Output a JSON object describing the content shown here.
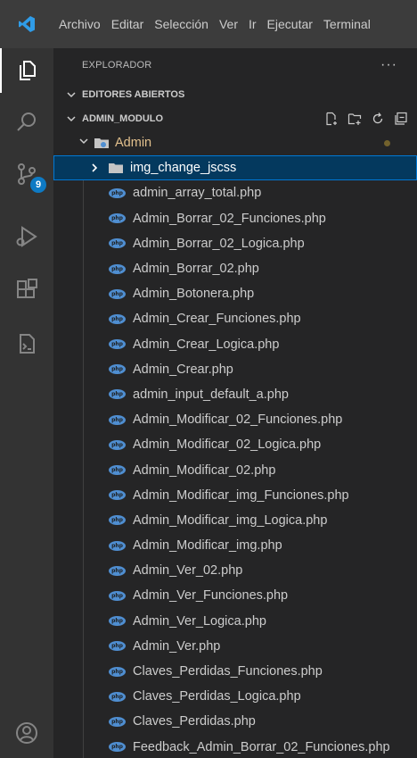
{
  "menubar": {
    "items": [
      "Archivo",
      "Editar",
      "Selección",
      "Ver",
      "Ir",
      "Ejecutar",
      "Terminal"
    ]
  },
  "activity_bar": {
    "icons": [
      "explorer-icon",
      "search-icon",
      "source-control-icon",
      "run-debug-icon",
      "extensions-icon",
      "remote-explorer-icon",
      "accounts-icon"
    ],
    "source_control_badge": "9"
  },
  "explorer": {
    "title": "EXPLORADOR",
    "more_label": "···",
    "open_editors_label": "EDITORES ABIERTOS",
    "workspace_label": "ADMIN_MODULO",
    "folder_label": "Admin",
    "subfolder_label": "img_change_jscss",
    "files": [
      "admin_array_total.php",
      "Admin_Borrar_02_Funciones.php",
      "Admin_Borrar_02_Logica.php",
      "Admin_Borrar_02.php",
      "Admin_Botonera.php",
      "Admin_Crear_Funciones.php",
      "Admin_Crear_Logica.php",
      "Admin_Crear.php",
      "admin_input_default_a.php",
      "Admin_Modificar_02_Funciones.php",
      "Admin_Modificar_02_Logica.php",
      "Admin_Modificar_02.php",
      "Admin_Modificar_img_Funciones.php",
      "Admin_Modificar_img_Logica.php",
      "Admin_Modificar_img.php",
      "Admin_Ver_02.php",
      "Admin_Ver_Funciones.php",
      "Admin_Ver_Logica.php",
      "Admin_Ver.php",
      "Claves_Perdidas_Funciones.php",
      "Claves_Perdidas_Logica.php",
      "Claves_Perdidas.php",
      "Feedback_Admin_Borrar_02_Funciones.php"
    ],
    "file_icon_text": "php"
  },
  "colors": {
    "accent": "#0078d4",
    "php_icon": "#4f8ed1",
    "folder_text": "#e2c08d"
  }
}
